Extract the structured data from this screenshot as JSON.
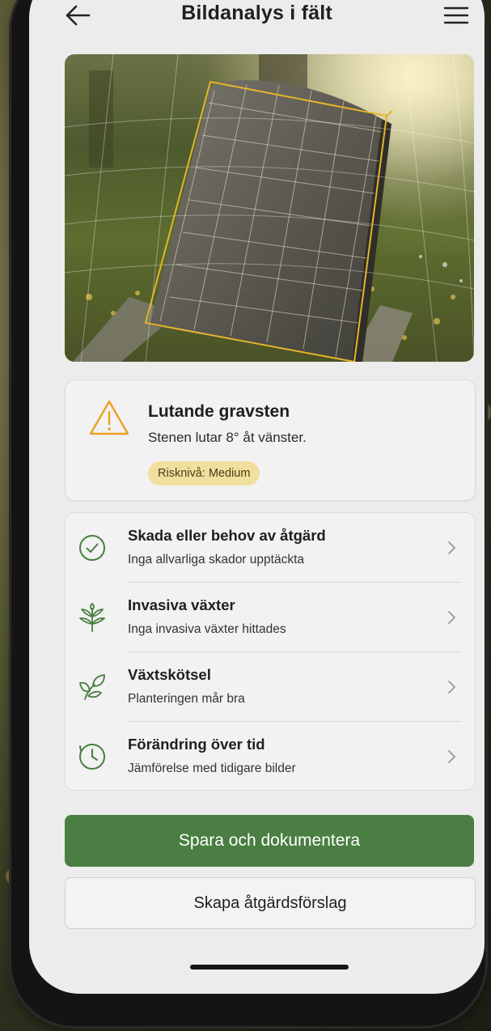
{
  "header": {
    "title": "Bildanalys i fält"
  },
  "icons": {
    "back": "arrow-left-icon",
    "menu": "hamburger-menu-icon"
  },
  "photo": {
    "alt": "gravestone-photo"
  },
  "alert": {
    "title": "Lutande gravsten",
    "text": "Stenen lutar 8° åt vänster.",
    "badge": "Risknivå: Medium",
    "icon": "warning-triangle-icon",
    "icon_color": "#e8a320",
    "badge_color": "#f1dfa0"
  },
  "items": [
    {
      "title": "Skada eller behov av åtgärd",
      "subtitle": "Inga allvarliga skador upptäckta",
      "icon": "check-circle-icon"
    },
    {
      "title": "Invasiva växter",
      "subtitle": "Inga invasiva växter hittades",
      "icon": "plant-icon"
    },
    {
      "title": "Växtskötsel",
      "subtitle": "Planteringen mår bra",
      "icon": "leaf-icon"
    },
    {
      "title": "Förändring över tid",
      "subtitle": "Jämförelse med tidigare bilder",
      "icon": "clock-icon"
    }
  ],
  "actions": {
    "primary": "Spara och dokumentera",
    "secondary": "Skapa åtgärdsförslag"
  },
  "colors": {
    "accent_green": "#4a7e42",
    "icon_green": "#4a7e42",
    "background": "#ececec"
  }
}
